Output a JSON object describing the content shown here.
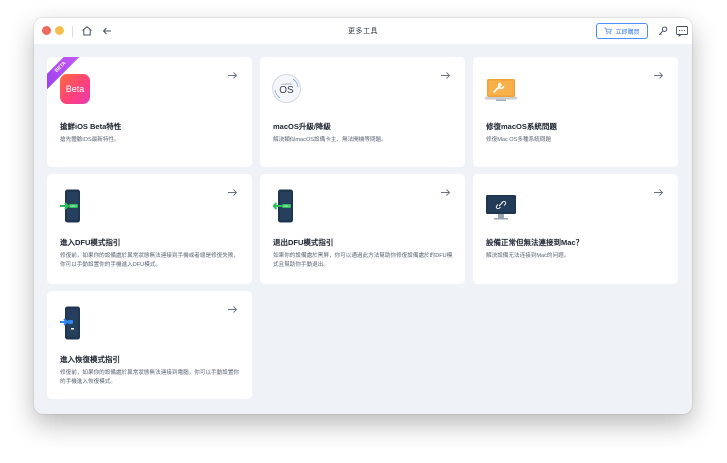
{
  "window": {
    "title": "更多工具"
  },
  "toolbar": {
    "buy_label": "立即購買"
  },
  "cards": [
    {
      "title": "搶鮮iOS Beta特性",
      "desc": "搶先體驗iOS最新特性。",
      "badge": "BETA",
      "icon_label": "Beta",
      "icon": "ios-beta-icon"
    },
    {
      "title": "macOS升級/降級",
      "desc": "解決類似macOS設備卡主、無法開機等問題。",
      "icon_small": "macOS",
      "icon_label": "OS",
      "icon": "macos-icon"
    },
    {
      "title": "修復macOS系統問題",
      "desc": "修復Mac OS多種系統問題",
      "icon": "macbook-wrench-icon"
    },
    {
      "title": "進入DFU模式指引",
      "desc": "修復前，如果你的設備處於異常狀態無法連接到手機或者總是修復失敗，你可以手動設置你的手機進入DFU模式。",
      "icon_label": "DFU",
      "icon": "enter-dfu-icon"
    },
    {
      "title": "退出DFU模式指引",
      "desc": "如果你的設備處於黑屏，你可以通過此方法幫助你修復設備處於的DFU模式且幫助你手動退出。",
      "icon_label": "DFU",
      "icon": "exit-dfu-icon"
    },
    {
      "title": "設備正常但無法連接到Mac？",
      "desc": "解決設備无法连接到Mac的问题。",
      "icon": "monitor-link-icon"
    },
    {
      "title": "進入恢復模式指引",
      "desc": "修復前，如果你的設備處於異常狀態無法連接到電腦，你可以手動設置你的手機進入恢復模式。",
      "icon": "recovery-mode-icon"
    }
  ],
  "colors": {
    "accent": "#3a7eef",
    "dfu_green": "#2dbf5c",
    "recovery_blue": "#2f86f0",
    "phone_dark": "#1f3650",
    "beta_gradient": "#ff3e7f",
    "ribbon_purple": "#b04ff1"
  }
}
